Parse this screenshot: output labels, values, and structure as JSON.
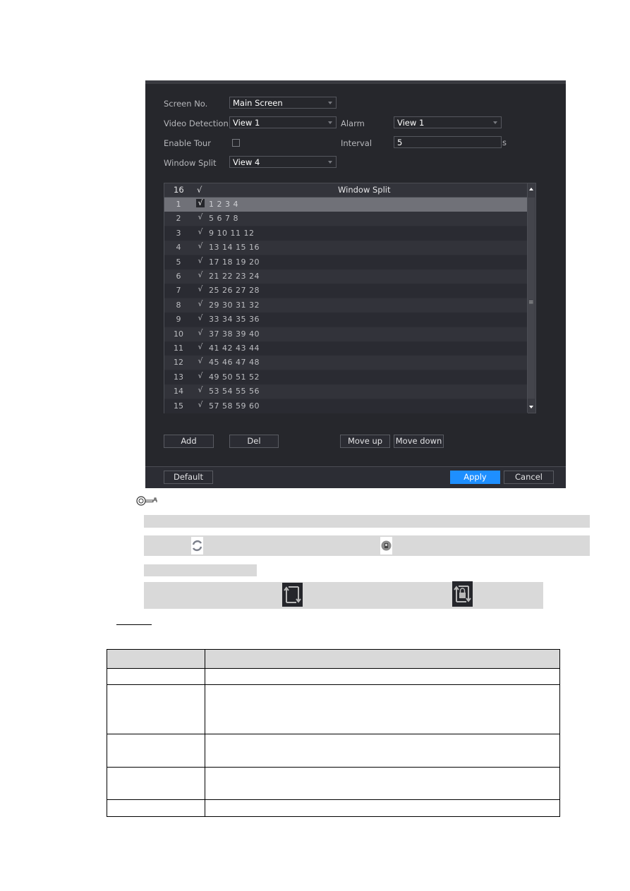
{
  "panel": {
    "screen_no": {
      "label": "Screen No.",
      "value": "Main Screen"
    },
    "video_detection": {
      "label": "Video Detection",
      "value": "View 1"
    },
    "alarm": {
      "label": "Alarm",
      "value": "View 1"
    },
    "enable_tour": {
      "label": "Enable Tour",
      "checked": false
    },
    "interval": {
      "label": "Interval",
      "value": "5",
      "unit": "s"
    },
    "window_split": {
      "label": "Window Split",
      "value": "View 4"
    },
    "table": {
      "header": {
        "count": "16",
        "check": "√",
        "title": "Window Split"
      },
      "rows": [
        {
          "no": "1",
          "check": "√",
          "channels": "1 2 3 4",
          "selected": true
        },
        {
          "no": "2",
          "check": "√",
          "channels": "5 6 7 8"
        },
        {
          "no": "3",
          "check": "√",
          "channels": "9 10 11 12"
        },
        {
          "no": "4",
          "check": "√",
          "channels": "13 14 15 16"
        },
        {
          "no": "5",
          "check": "√",
          "channels": "17 18 19 20"
        },
        {
          "no": "6",
          "check": "√",
          "channels": "21 22 23 24"
        },
        {
          "no": "7",
          "check": "√",
          "channels": "25 26 27 28"
        },
        {
          "no": "8",
          "check": "√",
          "channels": "29 30 31 32"
        },
        {
          "no": "9",
          "check": "√",
          "channels": "33 34 35 36"
        },
        {
          "no": "10",
          "check": "√",
          "channels": "37 38 39 40"
        },
        {
          "no": "11",
          "check": "√",
          "channels": "41 42 43 44"
        },
        {
          "no": "12",
          "check": "√",
          "channels": "45 46 47 48"
        },
        {
          "no": "13",
          "check": "√",
          "channels": "49 50 51 52"
        },
        {
          "no": "14",
          "check": "√",
          "channels": "53 54 55 56"
        },
        {
          "no": "15",
          "check": "√",
          "channels": "57 58 59 60"
        }
      ]
    },
    "buttons": {
      "add": "Add",
      "del": "Del",
      "move_up": "Move up",
      "move_down": "Move down",
      "default": "Default",
      "apply": "Apply",
      "cancel": "Cancel"
    },
    "colors": {
      "background": "#26272c",
      "accent": "#1e8fff"
    }
  },
  "note": {
    "icon": "key-icon",
    "inline_icons": [
      "refresh-cycle-icon",
      "camera-lock-icon",
      "tour-toggle-icon",
      "tour-lock-icon"
    ]
  }
}
